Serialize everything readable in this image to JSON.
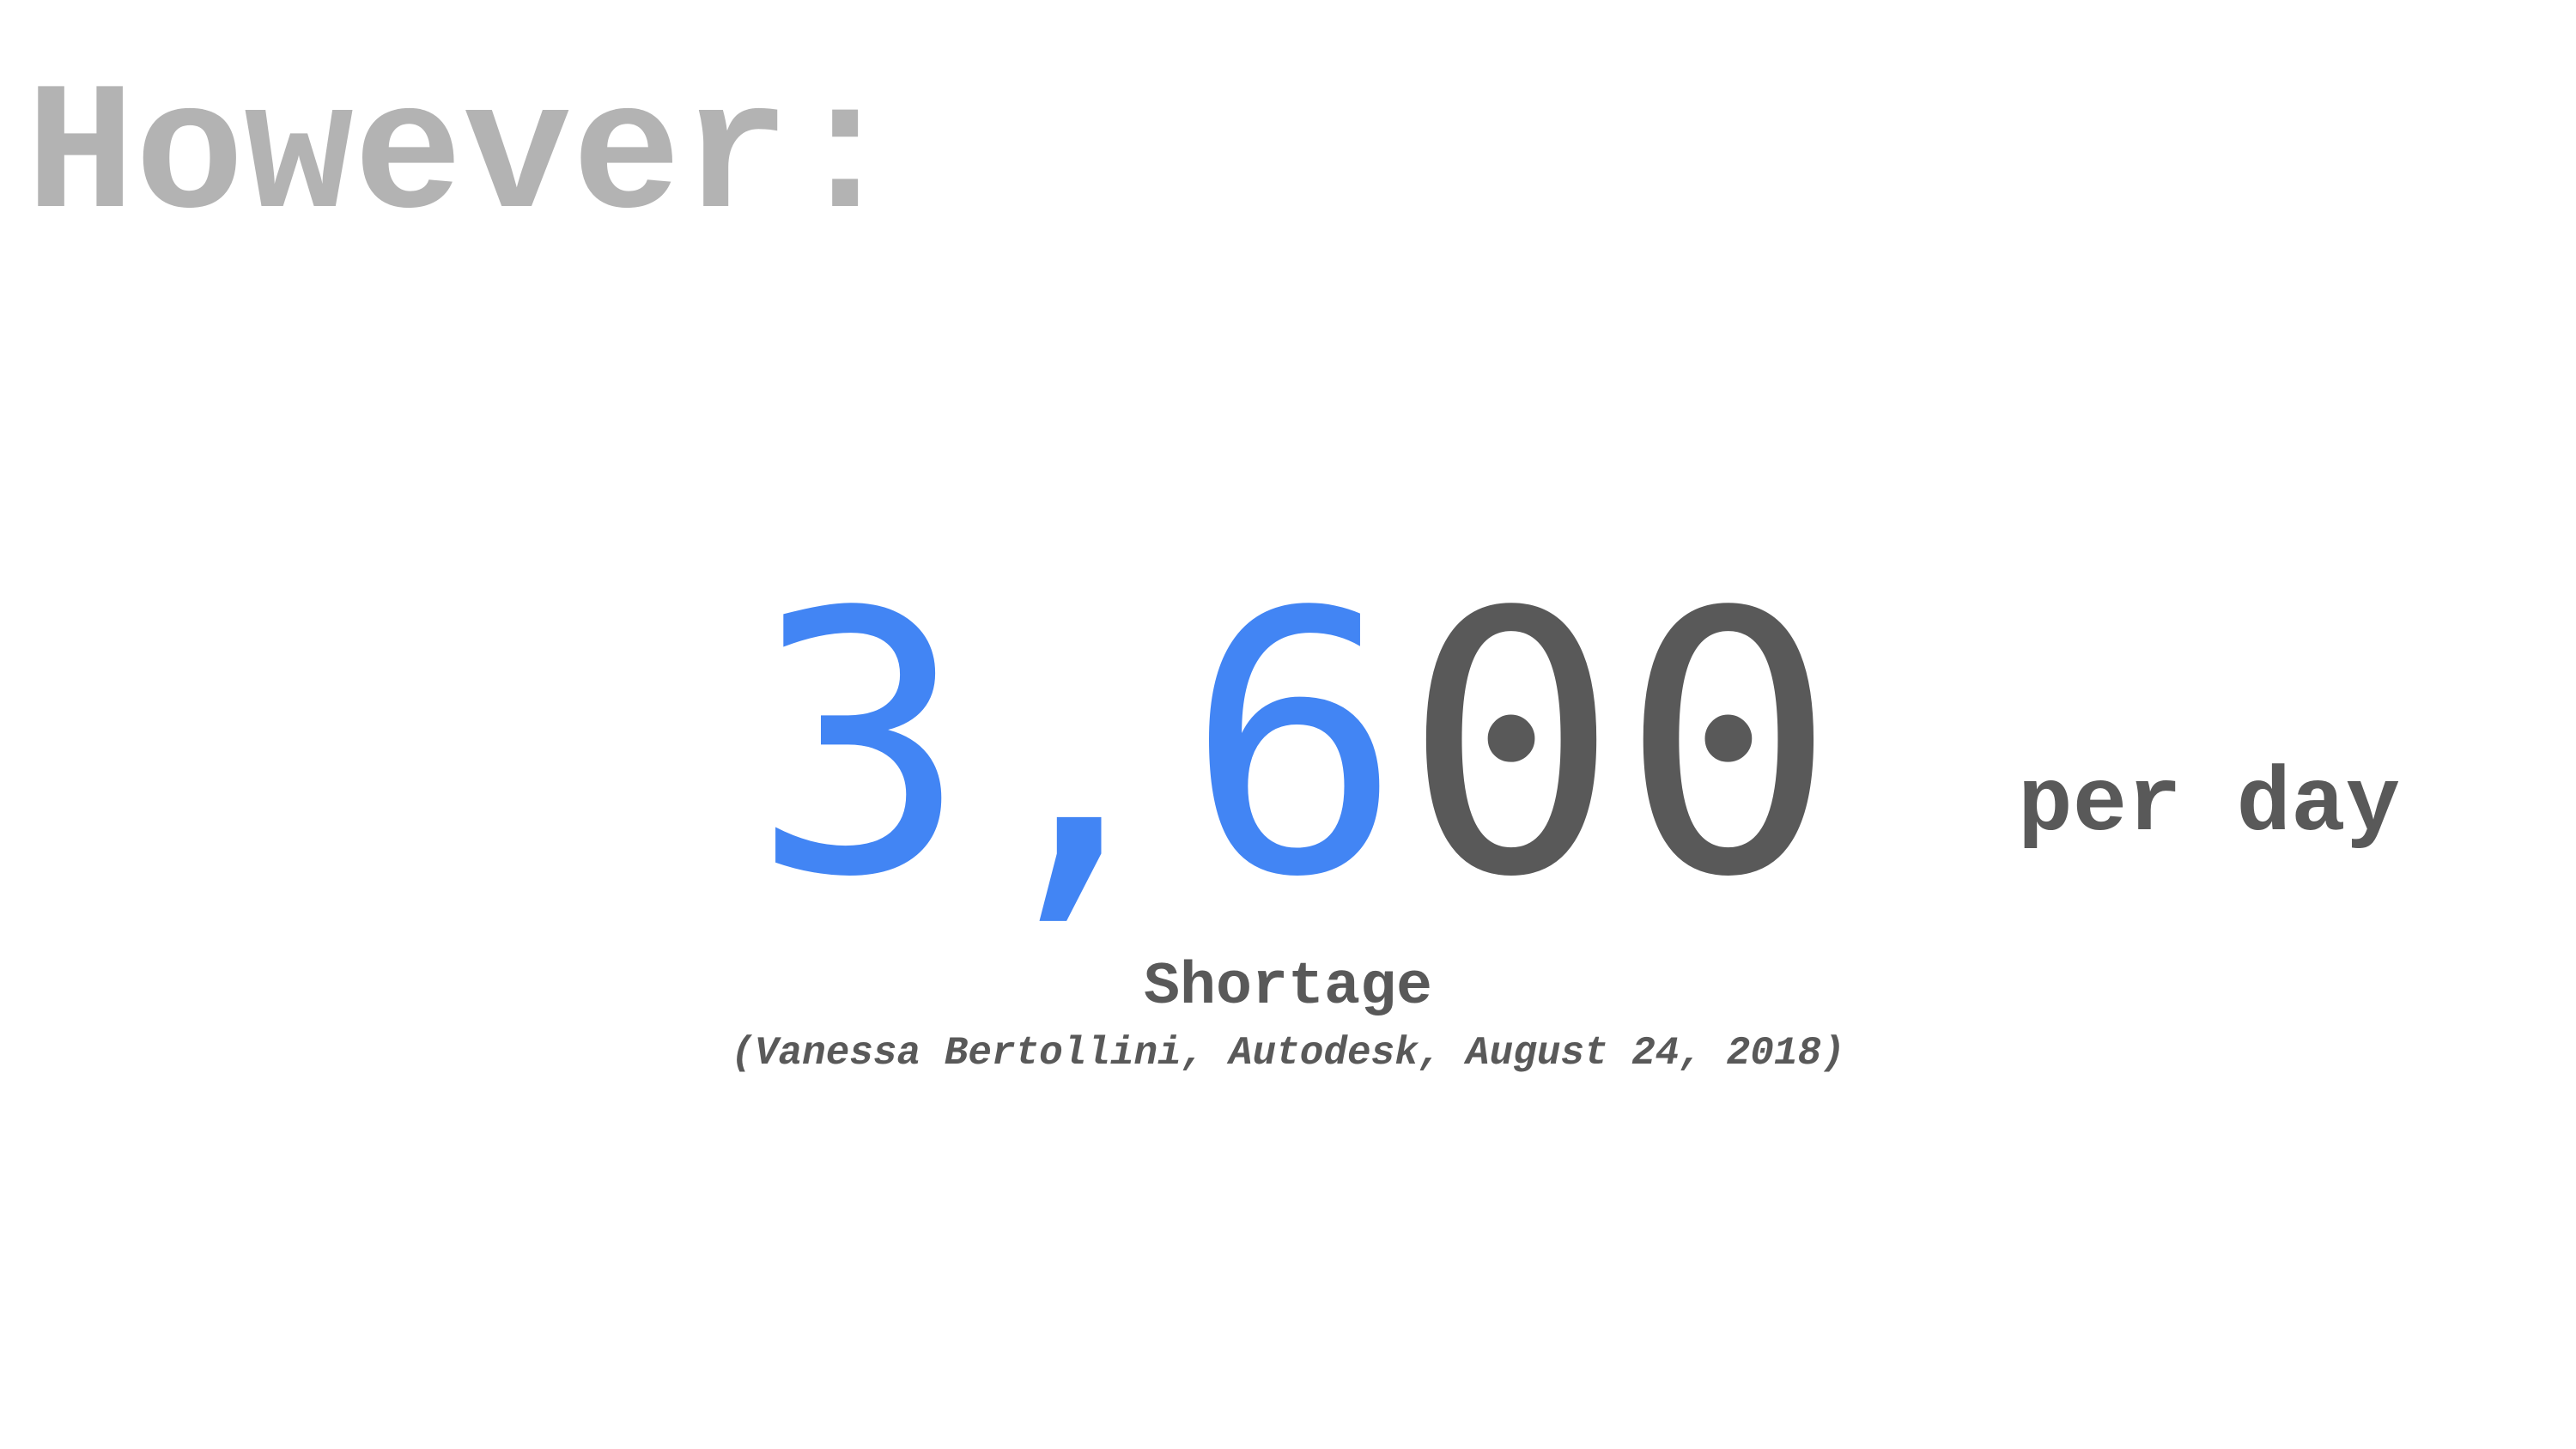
{
  "slide": {
    "heading": "However:",
    "number": {
      "part_blue": "3,6",
      "part_gray": "00"
    },
    "unit": "per day",
    "label": "Shortage",
    "source": "(Vanessa Bertollini, Autodesk, August 24, 2018)"
  },
  "colors": {
    "accent_blue": "#4285f4",
    "text_gray": "#595959",
    "heading_gray": "#b3b3b3"
  }
}
